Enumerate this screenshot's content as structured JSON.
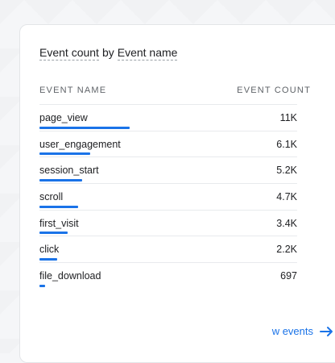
{
  "card": {
    "title_metric": "Event count",
    "title_by": "by",
    "title_dimension": "Event name",
    "col_name": "EVENT NAME",
    "col_count": "EVENT COUNT",
    "rows": [
      {
        "name": "page_view",
        "count": "11K",
        "fraction": 1.0
      },
      {
        "name": "user_engagement",
        "count": "6.1K",
        "fraction": 0.56
      },
      {
        "name": "session_start",
        "count": "5.2K",
        "fraction": 0.47
      },
      {
        "name": "scroll",
        "count": "4.7K",
        "fraction": 0.43
      },
      {
        "name": "first_visit",
        "count": "3.4K",
        "fraction": 0.31
      },
      {
        "name": "click",
        "count": "2.2K",
        "fraction": 0.2
      },
      {
        "name": "file_download",
        "count": "697",
        "fraction": 0.063
      }
    ],
    "link_label": "w events",
    "link_icon": "arrow-right-icon",
    "accent_color": "#1a73e8"
  }
}
